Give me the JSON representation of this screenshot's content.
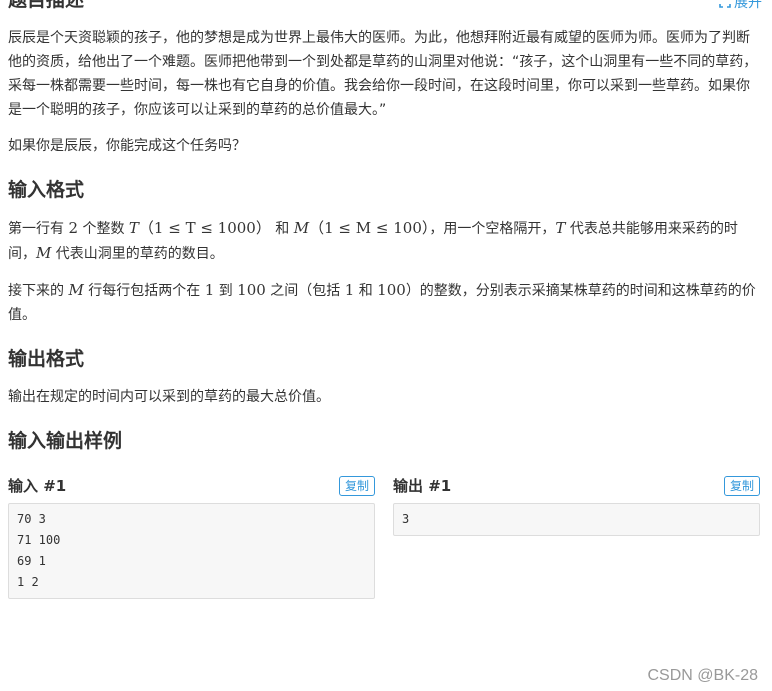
{
  "description": {
    "title": "题目描述",
    "expand_label": "展开",
    "para1": "辰辰是个天资聪颖的孩子，他的梦想是成为世界上最伟大的医师。为此，他想拜附近最有威望的医师为师。医师为了判断他的资质，给他出了一个难题。医师把他带到一个到处都是草药的山洞里对他说：“孩子，这个山洞里有一些不同的草药，采每一株都需要一些时间，每一株也有它自身的价值。我会给你一段时间，在这段时间里，你可以采到一些草药。如果你是一个聪明的孩子，你应该可以让采到的草药的总价值最大。”",
    "para2": "如果你是辰辰，你能完成这个任务吗？"
  },
  "input_format": {
    "title": "输入格式",
    "p1_a": "第一行有 ",
    "p1_num": "2",
    "p1_b": " 个整数 ",
    "p1_T": "T",
    "p1_T_range": "（1 ≤ T ≤ 1000）",
    "p1_c": " 和 ",
    "p1_M": "M",
    "p1_M_range": "（1 ≤ M ≤ 100）",
    "p1_d": "，用一个空格隔开，",
    "p1_T2": "T",
    "p1_e": " 代表总共能够用来采药的时间，",
    "p1_M2": "M",
    "p1_f": " 代表山洞里的草药的数目。",
    "p2_a": "接下来的 ",
    "p2_M": "M",
    "p2_b": " 行每行包括两个在 ",
    "p2_1": "1",
    "p2_c": " 到 ",
    "p2_100": "100",
    "p2_d": " 之间（包括 ",
    "p2_1b": "1",
    "p2_e": " 和 ",
    "p2_100b": "100",
    "p2_f": "）的整数，分别表示采摘某株草药的时间和这株草药的价值。"
  },
  "output_format": {
    "title": "输出格式",
    "p1": "输出在规定的时间内可以采到的草药的最大总价值。"
  },
  "samples": {
    "title": "输入输出样例",
    "copy_label": "复制",
    "input_title": "输入 #1",
    "input_lines": [
      "70 3",
      "71 100",
      "69 1",
      "1 2"
    ],
    "output_title": "输出 #1",
    "output_lines": [
      "3"
    ]
  },
  "watermark": "CSDN @BK-28",
  "colors": {
    "accent": "#3498db",
    "text": "#333333",
    "sample_bg": "#f7f7f7"
  }
}
